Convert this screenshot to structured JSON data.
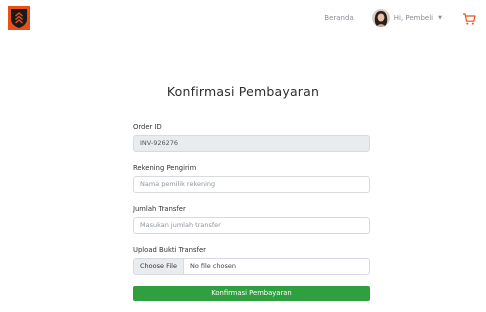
{
  "navbar": {
    "home_label": "Beranda",
    "user_greeting": "Hi, Pembeli",
    "brand_color": "#e8501a",
    "cart_color": "#e8501a"
  },
  "page": {
    "title": "Konfirmasi Pembayaran"
  },
  "form": {
    "order_id": {
      "label": "Order ID",
      "value": "INV-926276"
    },
    "sender_account": {
      "label": "Rekening Pengirim",
      "placeholder": "Nama pemilik rekening"
    },
    "transfer_amount": {
      "label": "Jumlah Transfer",
      "placeholder": "Masukan jumlah transfer"
    },
    "upload_proof": {
      "label": "Upload Bukti Transfer",
      "button_label": "Choose File",
      "status": "No file chosen"
    },
    "submit_label": "Konfirmasi Pembayaran",
    "submit_color": "#2f9f3f"
  },
  "icons": {
    "logo": "shield-logo-icon",
    "caret": "chevron-down-icon",
    "cart": "cart-icon",
    "avatar": "avatar"
  }
}
